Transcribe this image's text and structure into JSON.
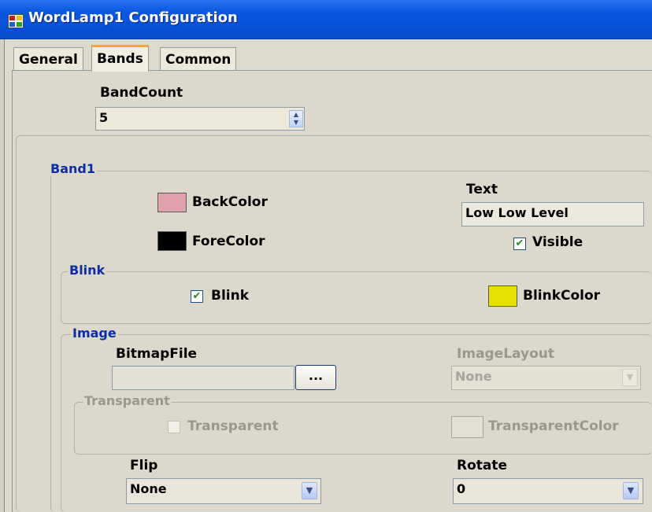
{
  "window": {
    "title": "WordLamp1 Configuration"
  },
  "tabs": [
    {
      "label": "General"
    },
    {
      "label": "Bands"
    },
    {
      "label": "Common"
    }
  ],
  "band_count": {
    "label": "BandCount",
    "value": "5"
  },
  "band1": {
    "legend": "Band1",
    "back_color_label": "BackColor",
    "back_color": "#e0a0ac",
    "fore_color_label": "ForeColor",
    "fore_color": "#000000",
    "text_label": "Text",
    "text_value": "Low Low Level",
    "visible_label": "Visible",
    "visible_checked": true
  },
  "blink": {
    "legend": "Blink",
    "blink_label": "Blink",
    "blink_checked": true,
    "blink_color_label": "BlinkColor",
    "blink_color": "#e6e100"
  },
  "image": {
    "legend": "Image",
    "bitmap_label": "BitmapFile",
    "bitmap_value": "",
    "browse_label": "...",
    "layout_label": "ImageLayout",
    "layout_value": "None",
    "transparent_legend": "Transparent",
    "transparent_label": "Transparent",
    "transparent_checked": false,
    "transparent_color_label": "TransparentColor"
  },
  "flip": {
    "label": "Flip",
    "value": "None"
  },
  "rotate": {
    "label": "Rotate",
    "value": "0"
  },
  "icons": {
    "app": "app-window-icon",
    "check": "checkmark-icon",
    "dropdown": "chevron-down-icon"
  }
}
